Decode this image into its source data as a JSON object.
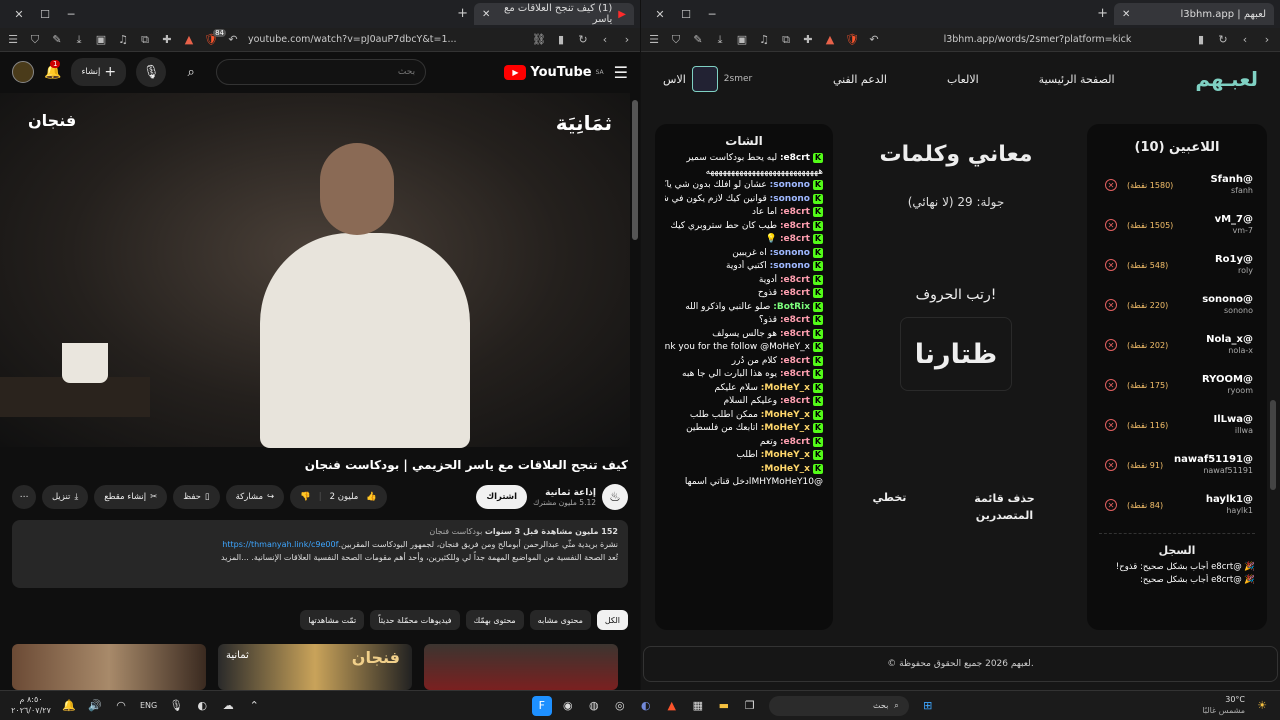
{
  "left_browser": {
    "tab_title": "(1) كيف تنجح العلاقات مع ياسر",
    "url": "youtube.com/watch?v=pJ0auP7dbcY&t=1...",
    "shield_count": "84"
  },
  "youtube": {
    "logo_text": "YouTube",
    "region": "SA",
    "search_placeholder": "بحث",
    "create_label": "إنشاء",
    "notif_count": "1",
    "video_watermark_right": "ثمَانِيَة",
    "video_watermark_left": "فنجان",
    "title": "كيف تنجح العلاقات مع ياسر الحزيمي | بودكاست فنجان",
    "channel_name": "إذاعة ثمانية",
    "subscribers": "5.12 مليون مشترك",
    "subscribe_label": "اشتراك",
    "likes": "2 مليون",
    "share_label": "مشاركة",
    "save_label": "حفظ",
    "clip_label": "إنشاء مقطع",
    "download_label": "تنزيل",
    "desc_stats": "152 مليون مشاهدة قبل 3 سنوات",
    "desc_tag": "بودكاست فنجان",
    "desc_line1": "نشرة بريدية مثّي عبدالرحمن أبومالح ومن فريق فنجان، لجمهور البودكاست المقربين.",
    "desc_link": "https://thmanyah.link/c9e00f",
    "desc_line2": "تُعد الصحة النفسية من المواضيع المهمة جداً لي وللكثيرين، وأحد أهم مقومات الصحة النفسية العلاقات الإنسانية. ...المزيد",
    "chips": [
      "الكل",
      "محتوى مشابه",
      "محتوى بهمّك",
      "فيديوهات محمّلة حديثاً",
      "تمّت مشاهدتها"
    ],
    "thumb1_text": "فنجان",
    "thumb2_text": "ثمانية"
  },
  "right_browser": {
    "tab_title": "لعبهم | l3bhm.app",
    "url": "l3bhm.app/words/2smer?platform=kick"
  },
  "site": {
    "brand": "لعبـهم",
    "nav": [
      "الصفحة الرئيسية",
      "الالعاب",
      "الدعم الفني"
    ],
    "nav_user": "2smer",
    "nav_cut": "الاس",
    "players_title": "اللاعبين (10)",
    "players": [
      {
        "name": "@Sfanh",
        "sub": "sfanh",
        "points": "(1580 نقطة)"
      },
      {
        "name": "@vM_7",
        "sub": "vm-7",
        "points": "(1505 نقطة)"
      },
      {
        "name": "@Ro1y",
        "sub": "roly",
        "points": "(548 نقطة)"
      },
      {
        "name": "@sonono",
        "sub": "sonono",
        "points": "(220 نقطة)"
      },
      {
        "name": "@Nola_x",
        "sub": "nola-x",
        "points": "(202 نقطة)"
      },
      {
        "name": "@RYOOM",
        "sub": "ryoom",
        "points": "(175 نقطة)"
      },
      {
        "name": "@IlLwa",
        "sub": "illwa",
        "points": "(116 نقطة)"
      },
      {
        "name": "@nawaf51191",
        "sub": "nawaf51191",
        "points": "(91 نقطة)"
      },
      {
        "name": "@haylk1",
        "sub": "haylk1",
        "points": "(84 نقطة)"
      }
    ],
    "log_title": "السجل",
    "log": [
      "@e8crt أجاب بشكل صحيح: قذوح!",
      "@e8crt أجاب بشكل صحيح:"
    ],
    "game_title": "معاني وكلمات",
    "round": "جولة: 29 (لا نهائي)",
    "prompt": "رتب الحروف!",
    "scramble": "ظتارنا",
    "btn_leaderboard": "حذف قائمة المتصدرين",
    "btn_skip": "تخطي",
    "chat_title": "الشات",
    "chat": [
      {
        "user": "e8crt:",
        "msg": "ليه يحط بودكاست سمير",
        "color": "#ffffff"
      },
      {
        "user": "",
        "msg": "هههههههههههههههههههههههههههه",
        "color": "#ffffff"
      },
      {
        "user": "sonono:",
        "msg": "عشان لو افلك بدون شي ياكل تحذير وينسحب منه بارتنره",
        "color": "#9fb8ff"
      },
      {
        "user": "sonono:",
        "msg": "قوانين كيك لازم يكون في شي شغال ويسولف",
        "color": "#9fb8ff"
      },
      {
        "user": "e8crt:",
        "msg": "اما عاد",
        "color": "#ff9fb0"
      },
      {
        "user": "e8crt:",
        "msg": "طيب كان حط ستروبري كيك",
        "color": "#ff9fb0"
      },
      {
        "user": "e8crt:",
        "msg": "💡",
        "color": "#ff9fb0"
      },
      {
        "user": "sonono:",
        "msg": "اه غريبين",
        "color": "#9fb8ff"
      },
      {
        "user": "sonono:",
        "msg": "اكتبي أدوية",
        "color": "#9fb8ff"
      },
      {
        "user": "e8crt:",
        "msg": "أدوية",
        "color": "#ff9fb0"
      },
      {
        "user": "e8crt:",
        "msg": "قذوح",
        "color": "#ff9fb0"
      },
      {
        "user": "BotRix:",
        "msg": "صلو عالنبي واذكرو الله",
        "color": "#7dff7d"
      },
      {
        "user": "e8crt:",
        "msg": "قذو؟",
        "color": "#ff9fb0"
      },
      {
        "user": "e8crt:",
        "msg": "هو جالس يسولف",
        "color": "#ff9fb0"
      },
      {
        "user": "BotRix:",
        "msg": "Thank you for the follow @MoHeY_x",
        "color": "#7dff7d"
      },
      {
        "user": "e8crt:",
        "msg": "كلام من دُرر",
        "color": "#ff9fb0"
      },
      {
        "user": "e8crt:",
        "msg": "يوه هذا البارت الي جا هبه",
        "color": "#ff9fb0"
      },
      {
        "user": "MoHeY_x:",
        "msg": "سلام عليكم",
        "color": "#ffd76b"
      },
      {
        "user": "e8crt:",
        "msg": "وعليكم السلام",
        "color": "#ff9fb0"
      },
      {
        "user": "MoHeY_x:",
        "msg": "ممكن اطلب طلب",
        "color": "#ffd76b"
      },
      {
        "user": "MoHeY_x:",
        "msg": "اتابعك من فلسطين",
        "color": "#ffd76b"
      },
      {
        "user": "e8crt:",
        "msg": "وتعم",
        "color": "#ff9fb0"
      },
      {
        "user": "MoHeY_x:",
        "msg": "اطلب",
        "color": "#ffd76b"
      },
      {
        "user": "MoHeY_x:",
        "msg": "",
        "color": "#ffd76b"
      },
      {
        "user": "",
        "msg": "@MHYMoHeY10ادخل قناتي اسمها",
        "color": "#ffffff"
      }
    ],
    "footer": "© لعبهم 2026 جميع الحقوق محفوظة."
  },
  "taskbar": {
    "time": "٨:٥٠ م",
    "date": "٢٠٢٦/٠٧/٢٧",
    "lang": "ENG",
    "search_placeholder": "بحث",
    "weather_temp": "30°C",
    "weather_desc": "مشمس غالبًا"
  }
}
